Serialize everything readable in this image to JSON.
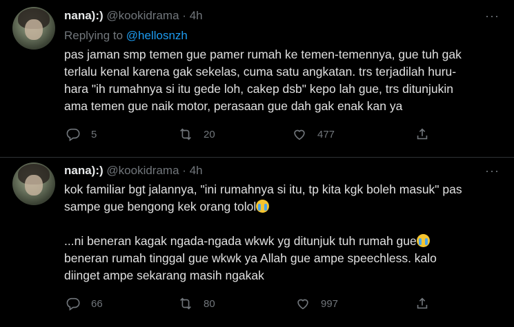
{
  "tweets": [
    {
      "name": "nana):)",
      "handle": "@kookidrama",
      "time": "4h",
      "reply_prefix": "Replying to",
      "reply_to": "@hellosnzh",
      "lines": [
        "pas jaman smp temen gue pamer rumah ke temen-temennya, gue tuh gak",
        "terlalu kenal karena gak sekelas, cuma satu angkatan. trs terjadilah huru-",
        "hara \"ih rumahnya si itu gede loh, cakep dsb\" kepo lah gue, trs ditunjukin",
        "ama temen gue naik motor, perasaan gue dah gak enak kan ya"
      ],
      "replies": "5",
      "retweets": "20",
      "likes": "477"
    },
    {
      "name": "nana):)",
      "handle": "@kookidrama",
      "time": "4h",
      "lines_a": [
        "kok familiar bgt jalannya, \"ini rumahnya si itu, tp kita kgk boleh masuk\" pas",
        "sampe gue bengong kek orang tolol"
      ],
      "lines_b": [
        "...ni beneran kagak ngada-ngada wkwk yg ditunjuk tuh rumah gue",
        "beneran rumah tinggal gue wkwk ya Allah gue ampe speechless. kalo",
        "diinget ampe sekarang masih ngakak"
      ],
      "replies": "66",
      "retweets": "80",
      "likes": "997"
    }
  ],
  "icons": {
    "reply": "reply-icon",
    "retweet": "retweet-icon",
    "like": "heart-icon",
    "share": "share-icon",
    "more": "more-icon",
    "emoji": "crying-face-emoji"
  },
  "colors": {
    "background": "#000000",
    "link": "#1d9bf0",
    "muted": "#71767b"
  }
}
